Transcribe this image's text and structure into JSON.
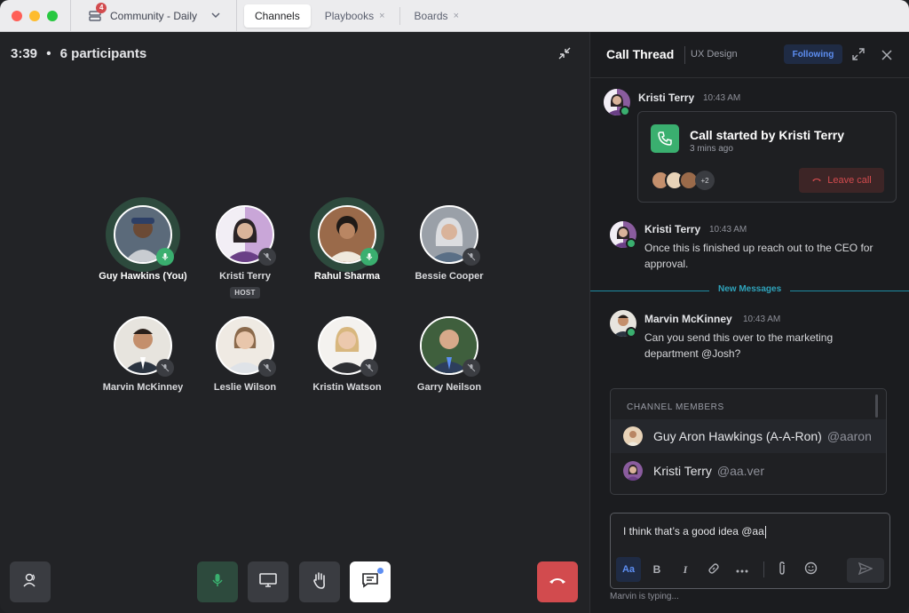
{
  "titlebar": {
    "workspace": "Community - Daily",
    "badge_count": "4",
    "tabs": [
      {
        "label": "Channels",
        "active": true,
        "closable": false
      },
      {
        "label": "Playbooks",
        "active": false,
        "closable": true
      },
      {
        "label": "Boards",
        "active": false,
        "closable": true
      }
    ],
    "close_glyph": "×"
  },
  "call": {
    "duration": "3:39",
    "separator": "•",
    "participants_label": "6 participants",
    "participants": [
      {
        "name": "Guy Hawkins (You)",
        "speaking": true,
        "muted": false,
        "color": "#5b6a7a"
      },
      {
        "name": "Kristi Terry",
        "speaking": false,
        "muted": true,
        "host": "HOST",
        "color": "#8a5c9e"
      },
      {
        "name": "Rahul Sharma",
        "speaking": true,
        "muted": false,
        "color": "#a07a55"
      },
      {
        "name": "Bessie Cooper",
        "speaking": false,
        "muted": true,
        "color": "#9aa0a8"
      },
      {
        "name": "Marvin McKinney",
        "speaking": false,
        "muted": true,
        "color": "#6f5a4e"
      },
      {
        "name": "Leslie Wilson",
        "speaking": false,
        "muted": true,
        "color": "#b9a58e"
      },
      {
        "name": "Kristin Watson",
        "speaking": false,
        "muted": true,
        "color": "#c9b08a"
      },
      {
        "name": "Garry Neilson",
        "speaking": false,
        "muted": true,
        "color": "#4b6b4a"
      }
    ],
    "controls": [
      {
        "name": "participants-button",
        "icon": "participants-icon"
      },
      {
        "name": "mute-button",
        "icon": "microphone-icon"
      },
      {
        "name": "share-screen-button",
        "icon": "monitor-icon"
      },
      {
        "name": "raise-hand-button",
        "icon": "hand-icon"
      },
      {
        "name": "chat-button",
        "icon": "chat-icon"
      },
      {
        "name": "leave-call-button",
        "icon": "hangup-icon"
      }
    ]
  },
  "thread": {
    "title": "Call Thread",
    "channel": "UX Design",
    "following_label": "Following",
    "messages": [
      {
        "author": "Kristi Terry",
        "time": "10:43 AM"
      },
      {
        "author": "Kristi Terry",
        "time": "10:43 AM",
        "text": "Once this is finished up reach out to the CEO for approval."
      },
      {
        "author": "Marvin McKinney",
        "time": "10:43 AM",
        "text": "Can you send this over to the marketing department @Josh?"
      }
    ],
    "call_card": {
      "title": "Call started by Kristi Terry",
      "subtitle": "3 mins ago",
      "more_count": "+2",
      "leave_label": "Leave call"
    },
    "new_messages_label": "New Messages",
    "suggestions": {
      "header": "CHANNEL MEMBERS",
      "items": [
        {
          "name": "Guy Aron Hawkings (A-A-Ron)",
          "handle": "@aaron"
        },
        {
          "name": "Kristi Terry",
          "handle": "@aa.ver"
        }
      ]
    },
    "composer": {
      "text": "I think that’s a good idea @aa",
      "format_buttons": [
        "Aa",
        "B",
        "I"
      ],
      "typing": "Marvin is typing..."
    }
  },
  "colors": {
    "accent_green": "#3aaf6f",
    "danger_red": "#d24b4e",
    "link_blue": "#5d8ef2",
    "new_messages_teal": "#2fa3bb"
  }
}
